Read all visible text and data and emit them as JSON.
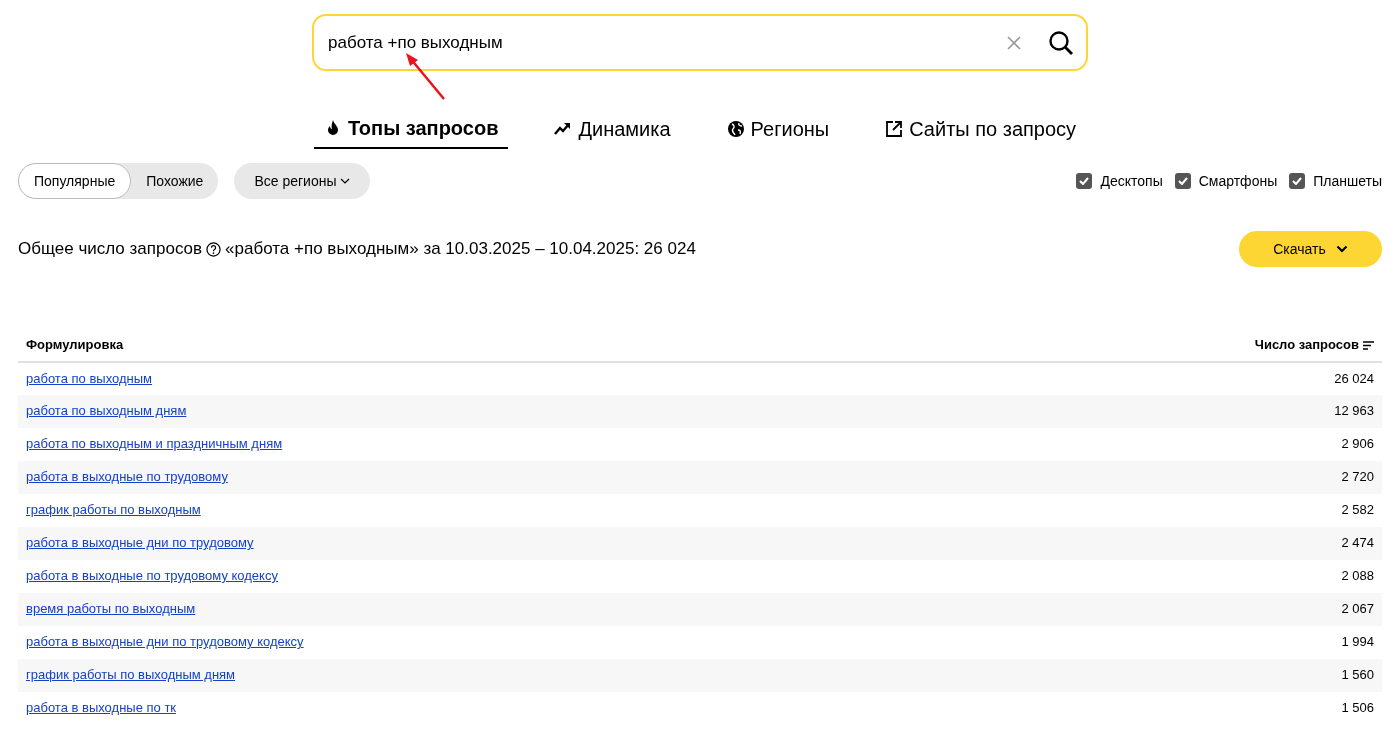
{
  "search": {
    "value": "работа +по выходным"
  },
  "tabs": [
    {
      "label": "Топы запросов",
      "selected": true
    },
    {
      "label": "Динамика",
      "selected": false
    },
    {
      "label": "Регионы",
      "selected": false
    },
    {
      "label": "Сайты по запросу",
      "selected": false
    }
  ],
  "modes": [
    {
      "label": "Популярные",
      "selected": true
    },
    {
      "label": "Похожие",
      "selected": false
    }
  ],
  "region_button": "Все регионы",
  "devices": [
    {
      "label": "Десктопы",
      "checked": true
    },
    {
      "label": "Смартфоны",
      "checked": true
    },
    {
      "label": "Планшеты",
      "checked": true
    }
  ],
  "summary": {
    "label": "Общее число запросов",
    "text": "«работа +по выходным» за 10.03.2025 – 10.04.2025: 26 024"
  },
  "download_button": "Скачать",
  "table": {
    "columns": [
      "Формулировка",
      "Число запросов"
    ],
    "rows": [
      [
        "работа по выходным",
        "26 024"
      ],
      [
        "работа по выходным дням",
        "12 963"
      ],
      [
        "работа по выходным и праздничным дням",
        "2 906"
      ],
      [
        "работа в выходные по трудовому",
        "2 720"
      ],
      [
        "график работы по выходным",
        "2 582"
      ],
      [
        "работа в выходные дни по трудовому",
        "2 474"
      ],
      [
        "работа в выходные по трудовому кодексу",
        "2 088"
      ],
      [
        "время работы по выходным",
        "2 067"
      ],
      [
        "работа в выходные дни по трудовому кодексу",
        "1 994"
      ],
      [
        "график работы по выходным дням",
        "1 560"
      ],
      [
        "работа в выходные по тк",
        "1 506"
      ]
    ]
  }
}
